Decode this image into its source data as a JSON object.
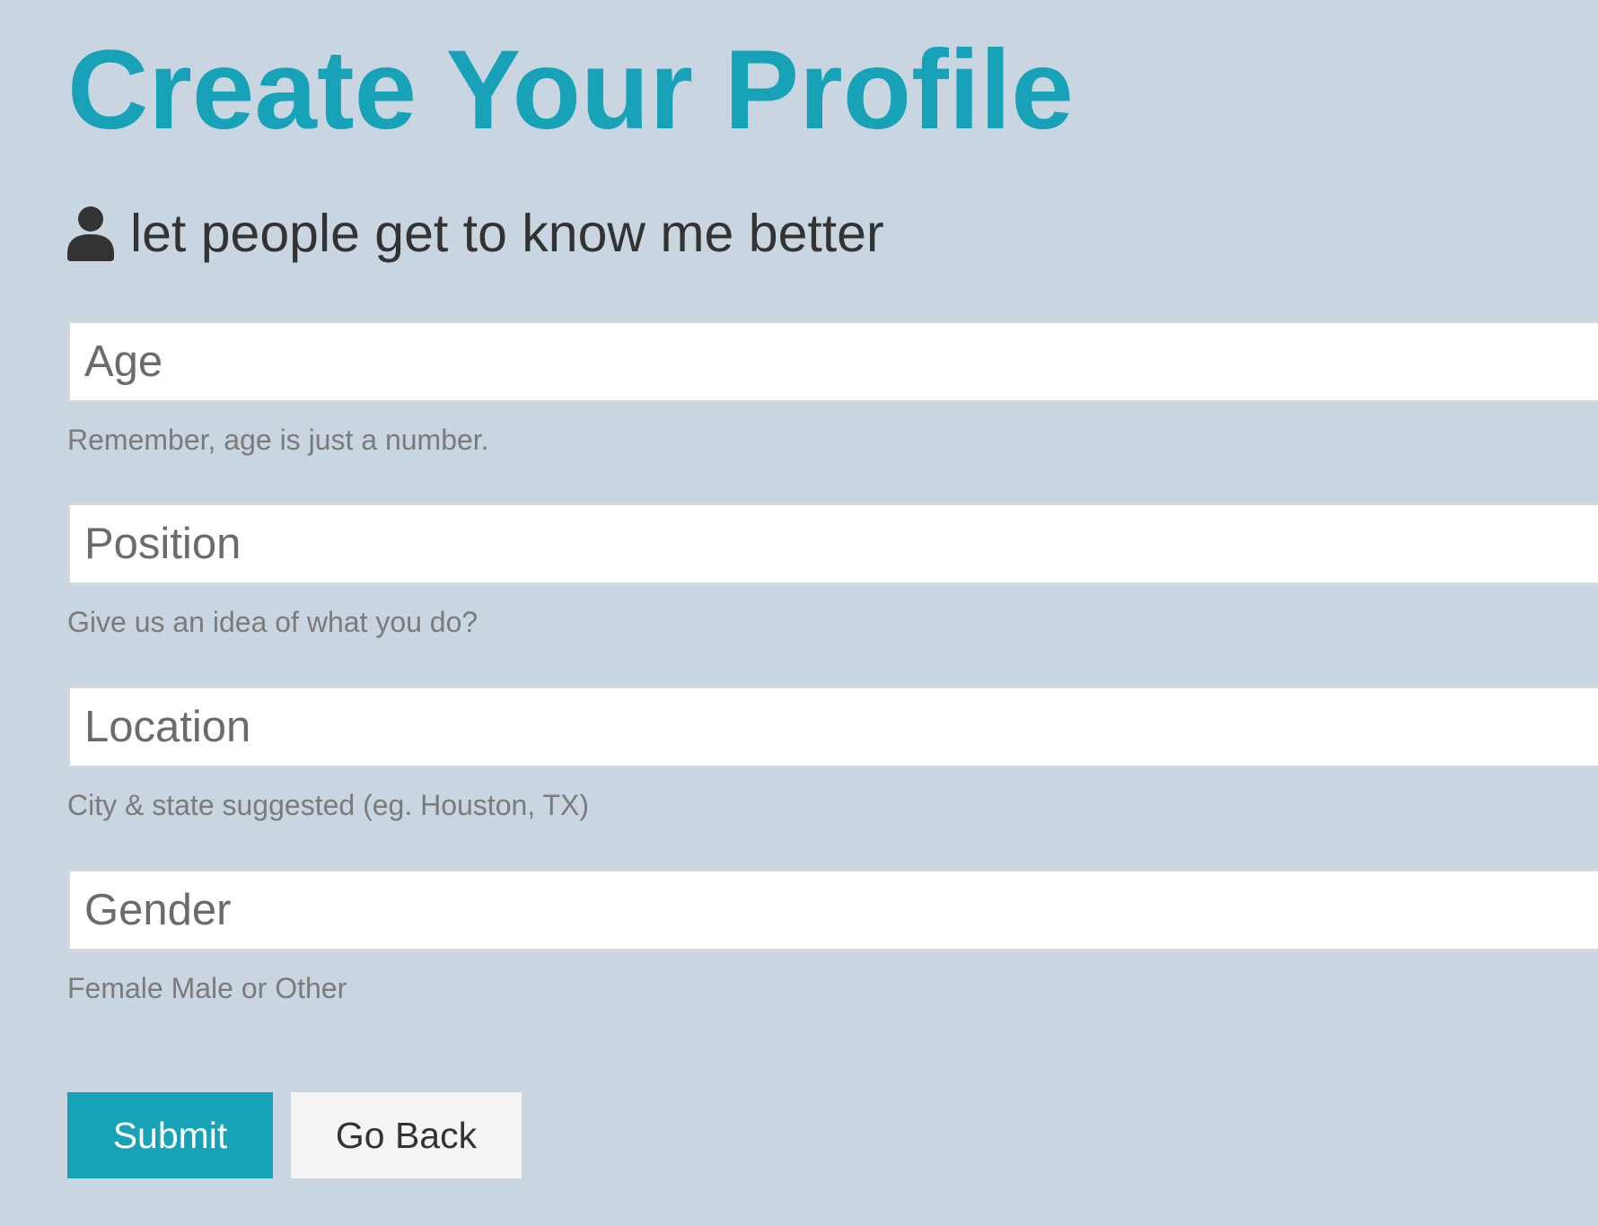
{
  "page": {
    "title": "Create Your Profile",
    "lead": {
      "icon": "user-icon",
      "text": "let people get to know me better"
    }
  },
  "form": {
    "fields": [
      {
        "placeholder": "Age",
        "value": "",
        "help": "Remember, age is just a number."
      },
      {
        "placeholder": "Position",
        "value": "",
        "help": "Give us an idea of what you do?"
      },
      {
        "placeholder": "Location",
        "value": "",
        "help": "City & state suggested (eg. Houston, TX)"
      },
      {
        "placeholder": "Gender",
        "value": "",
        "help": "Female Male or Other"
      }
    ],
    "submit_label": "Submit",
    "back_label": "Go Back"
  },
  "colors": {
    "background": "#c9d5e1",
    "accent": "#17a2b8",
    "text": "#333333",
    "muted": "#7b7b7b"
  }
}
